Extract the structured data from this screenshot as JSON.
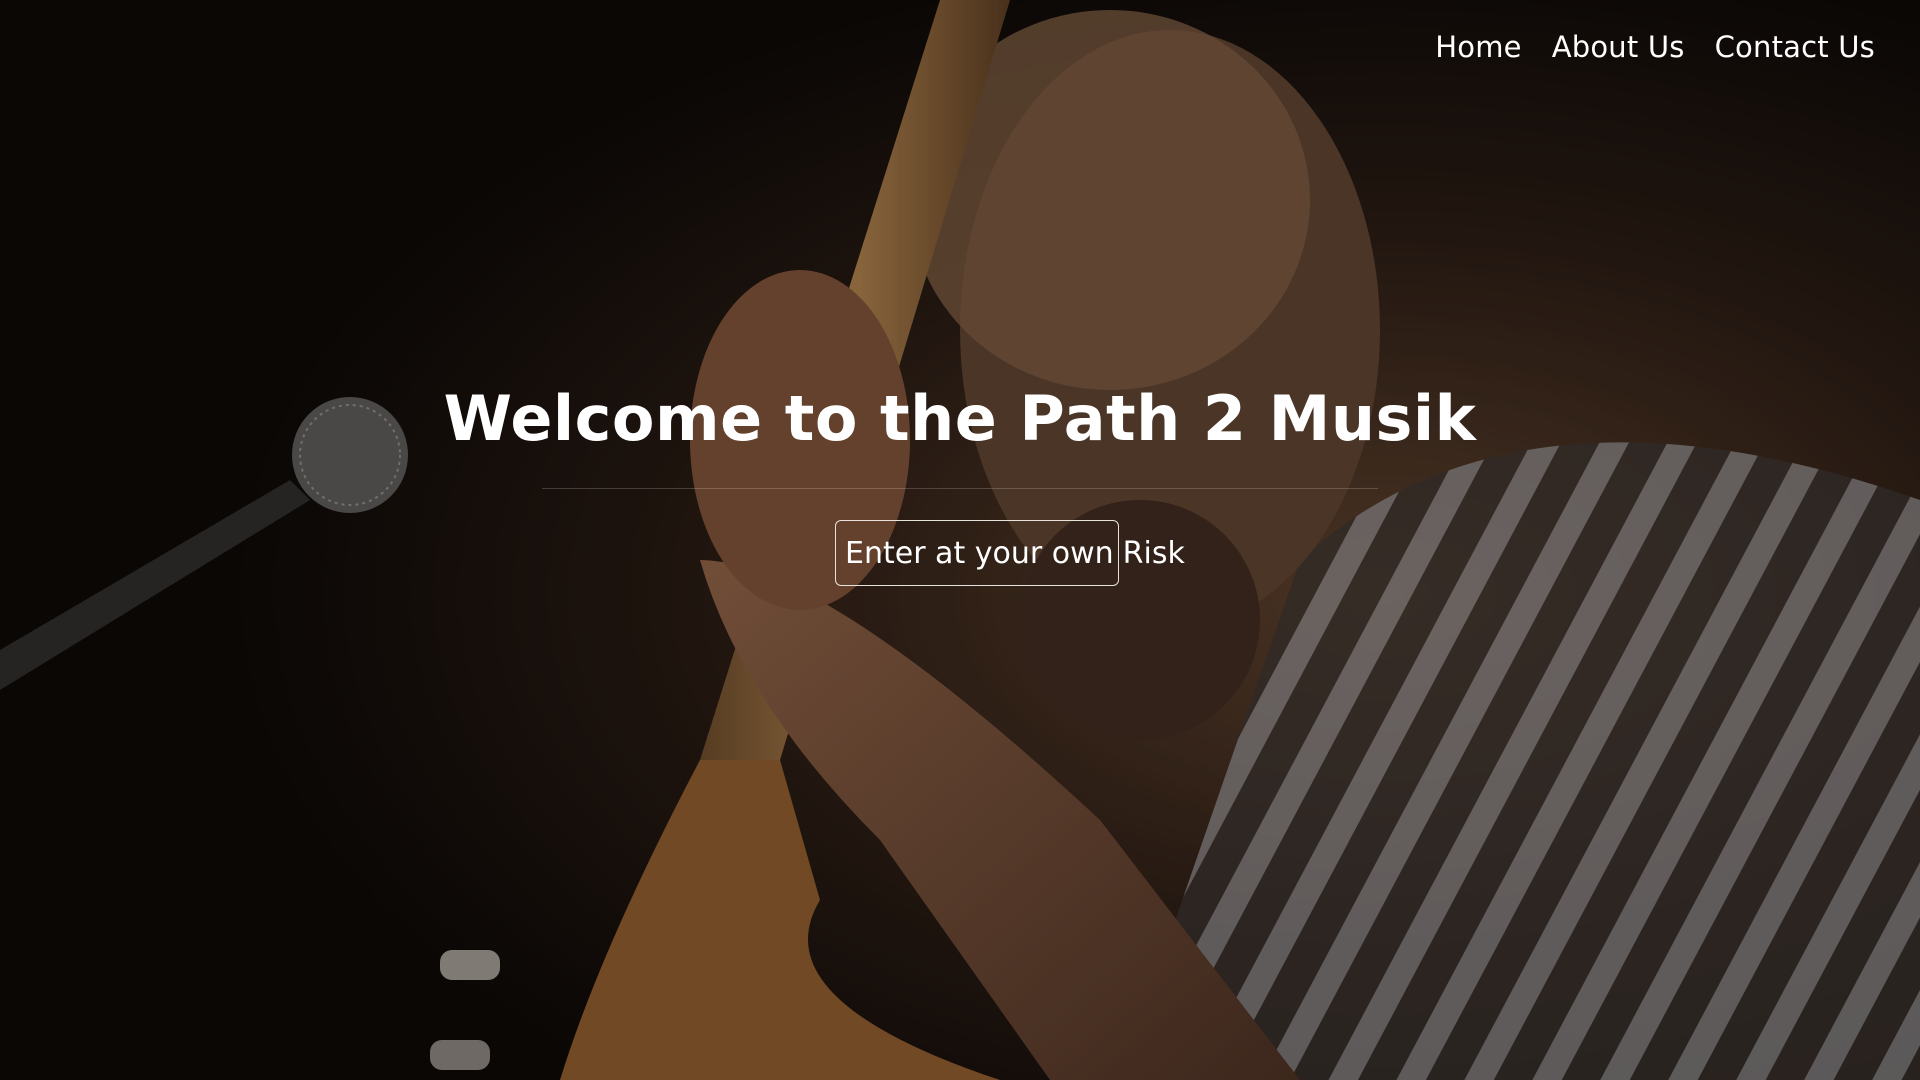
{
  "nav": {
    "items": [
      {
        "label": "Home"
      },
      {
        "label": "About Us"
      },
      {
        "label": "Contact Us"
      }
    ]
  },
  "hero": {
    "title": "Welcome to the Path 2 Musik",
    "button_label": "Enter at your own",
    "button_tail": "Risk"
  },
  "background": {
    "description_icon": "musician-playing-double-bass-photo",
    "base_color": "#0e0a08"
  }
}
